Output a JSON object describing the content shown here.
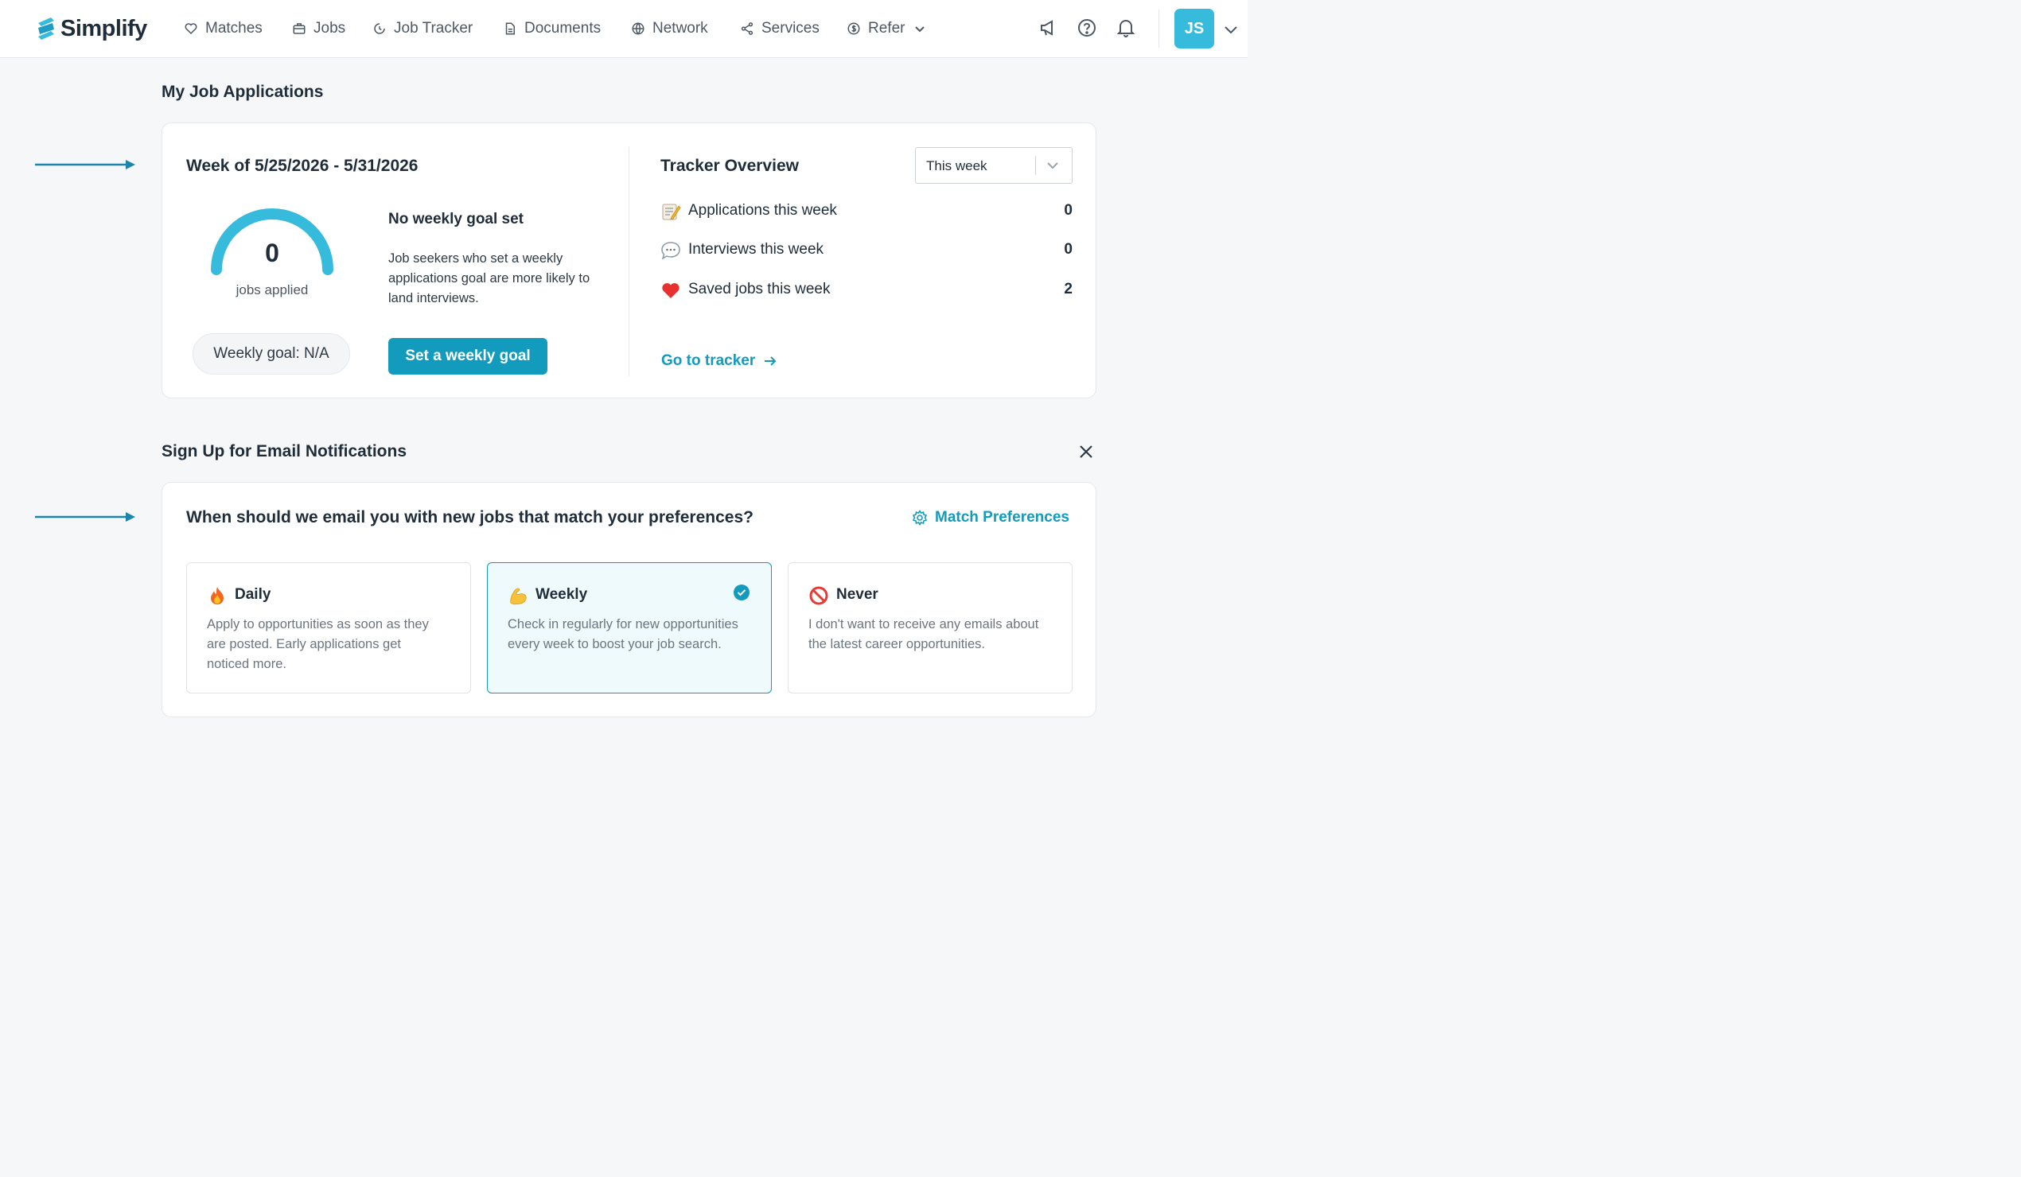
{
  "nav": {
    "brand": "Simplify",
    "items": [
      {
        "label": "Matches",
        "icon": "heart-icon"
      },
      {
        "label": "Jobs",
        "icon": "briefcase-icon"
      },
      {
        "label": "Job Tracker",
        "icon": "tracker-icon"
      },
      {
        "label": "Documents",
        "icon": "document-icon"
      },
      {
        "label": "Network",
        "icon": "globe-icon"
      },
      {
        "label": "Services",
        "icon": "share-icon"
      },
      {
        "label": "Refer",
        "icon": "dollar-icon"
      }
    ],
    "user_initials": "JS"
  },
  "applications": {
    "section_title": "My Job Applications",
    "week_title": "Week of 5/25/2026 - 5/31/2026",
    "jobs_applied_count": "0",
    "jobs_applied_label": "jobs applied",
    "weekly_goal": "Weekly goal: N/A",
    "no_goal_title": "No weekly goal set",
    "no_goal_text": "Job seekers who set a weekly applications goal are more likely to land interviews.",
    "set_goal_button": "Set a weekly goal",
    "tracker_title": "Tracker Overview",
    "period_select": "This week",
    "stats": [
      {
        "emoji": "memo",
        "label": "Applications this week",
        "value": "0"
      },
      {
        "emoji": "speech-bubble",
        "label": "Interviews this week",
        "value": "0"
      },
      {
        "emoji": "red-heart",
        "label": "Saved jobs this week",
        "value": "2"
      }
    ],
    "tracker_link": "Go to tracker"
  },
  "email": {
    "section_title": "Sign Up for Email Notifications",
    "question": "When should we email you with new jobs that match your preferences?",
    "preferences_link": "Match Preferences",
    "options": [
      {
        "emoji": "fire",
        "title": "Daily",
        "desc": "Apply to opportunities as soon as they are posted. Early applications get noticed more.",
        "selected": false
      },
      {
        "emoji": "flexed-biceps",
        "title": "Weekly",
        "desc": "Check in regularly for new opportunities every week to boost your job search.",
        "selected": true
      },
      {
        "emoji": "prohibited",
        "title": "Never",
        "desc": "I don't want to receive any emails about the latest career opportunities.",
        "selected": false
      }
    ]
  },
  "colors": {
    "accent": "#139bbd",
    "gauge": "#37bbdc",
    "avatar": "#37bbdc",
    "arrow": "#1a86ad"
  }
}
